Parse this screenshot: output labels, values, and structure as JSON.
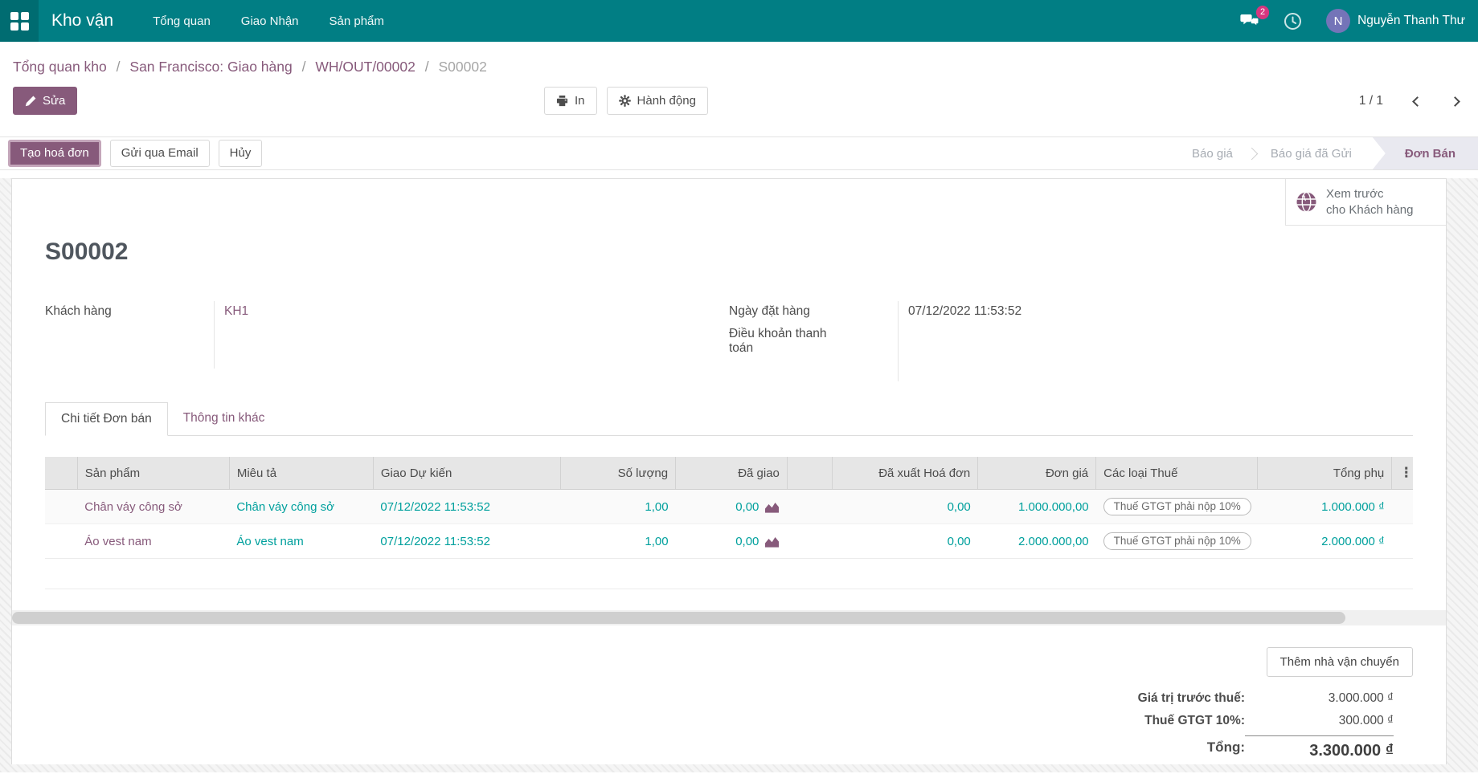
{
  "topbar": {
    "brand": "Kho vận",
    "menus": [
      "Tổng quan",
      "Giao Nhận",
      "Sản phẩm"
    ],
    "badge": "2",
    "user_initial": "N",
    "user_name": "Nguyễn Thanh Thư"
  },
  "breadcrumb": {
    "separator": "/",
    "items": [
      "Tổng quan kho",
      "San Francisco: Giao hàng",
      "WH/OUT/00002"
    ],
    "current": "S00002"
  },
  "control": {
    "edit": "Sửa",
    "print": "In",
    "action": "Hành động",
    "pager": "1 / 1"
  },
  "statusbar": {
    "create_invoice": "Tạo hoá đơn",
    "send_email": "Gửi qua Email",
    "cancel": "Hủy",
    "steps": [
      {
        "label": "Báo giá",
        "active": false
      },
      {
        "label": "Báo giá đã Gửi",
        "active": false
      },
      {
        "label": "Đơn Bán",
        "active": true
      }
    ]
  },
  "preview": {
    "line1": "Xem trước",
    "line2": "cho Khách hàng"
  },
  "form": {
    "title": "S00002",
    "customer_label": "Khách hàng",
    "customer_value": "KH1",
    "order_date_label": "Ngày đặt hàng",
    "order_date_value": "07/12/2022 11:53:52",
    "payment_terms_label": "Điều khoản thanh toán",
    "payment_terms_value": "",
    "tabs": {
      "details": "Chi tiết Đơn bán",
      "other": "Thông tin khác"
    }
  },
  "lines": {
    "columns": [
      "",
      "Sản phẩm",
      "Miêu tả",
      "Giao Dự kiến",
      "Số lượng",
      "Đã giao",
      "",
      "Đã xuất Hoá đơn",
      "Đơn giá",
      "Các loại Thuế",
      "Tổng phụ"
    ],
    "kebab": "⋮",
    "rows": [
      {
        "product": "Chân váy công sở",
        "description": "Chân váy công sở",
        "scheduled_date": "07/12/2022 11:53:52",
        "quantity": "1,00",
        "delivered": "0,00",
        "invoiced": "0,00",
        "unit_price": "1.000.000,00",
        "taxes": "Thuế GTGT phải nộp 10%",
        "subtotal": "1.000.000 ₫"
      },
      {
        "product": "Áo vest nam",
        "description": "Áo vest nam",
        "scheduled_date": "07/12/2022 11:53:52",
        "quantity": "1,00",
        "delivered": "0,00",
        "invoiced": "0,00",
        "unit_price": "2.000.000,00",
        "taxes": "Thuế GTGT phải nộp 10%",
        "subtotal": "2.000.000 ₫"
      }
    ]
  },
  "totals": {
    "add_shipping": "Thêm nhà vận chuyển",
    "untaxed_label": "Giá trị trước thuế:",
    "untaxed_value": "3.000.000 ₫",
    "tax_label": "Thuế GTGT 10%:",
    "tax_value": "300.000 ₫",
    "total_label": "Tổng:",
    "total_value": "3.300.000 ₫"
  },
  "colors": {
    "brand_teal": "#017e84",
    "accent_purple": "#875A7B",
    "value_teal": "#00a09d",
    "badge_pink": "#d6367f",
    "avatar_indigo": "#7474b8"
  }
}
